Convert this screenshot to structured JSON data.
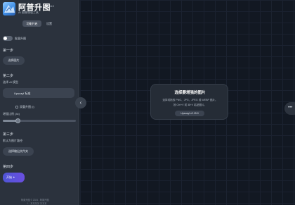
{
  "app": {
    "title": "阿普升图",
    "version": "2.16.0",
    "subtitle": "AI 图像增强工具"
  },
  "tabs": [
    {
      "label": "功能开启"
    },
    {
      "label": "设置"
    }
  ],
  "toggle": {
    "label": "批量升图",
    "on": false
  },
  "steps": {
    "step1": {
      "title": "第一步",
      "button": "选择图片"
    },
    "step2": {
      "title": "第二步",
      "model_label": "选择 AI 模型",
      "model_value": "Upscayl 标准",
      "double_label": "双重升图 (i)",
      "scale_label": "增强比例 (4x)",
      "scale_value": 0.2
    },
    "step3": {
      "title": "第三步",
      "hint": "默认为图片路径",
      "button": "选择输出文件夹"
    },
    "step4": {
      "title": "第四步",
      "button": "开始"
    }
  },
  "footer": {
    "line1": "阿普升图 © 2024 - 阿普升图",
    "line2": "Y... 某某某某 某某某"
  },
  "main": {
    "drop_title": "选择要增强的图片",
    "drop_desc1": "选择或拖放 PNG、JPG、JPEG 或 WEBP 图片。",
    "drop_desc2": "按 Ctrl+V 或 ⌘+V 粘贴图片。",
    "badge": "Upscayl v2.15.0"
  },
  "icons": {
    "collapse": "chevron-left-icon",
    "more": "more-horizontal-icon",
    "start": "wand-icon"
  },
  "colors": {
    "accent": "#5a52dc",
    "sidebar": "#2b323d",
    "background": "#121822"
  }
}
